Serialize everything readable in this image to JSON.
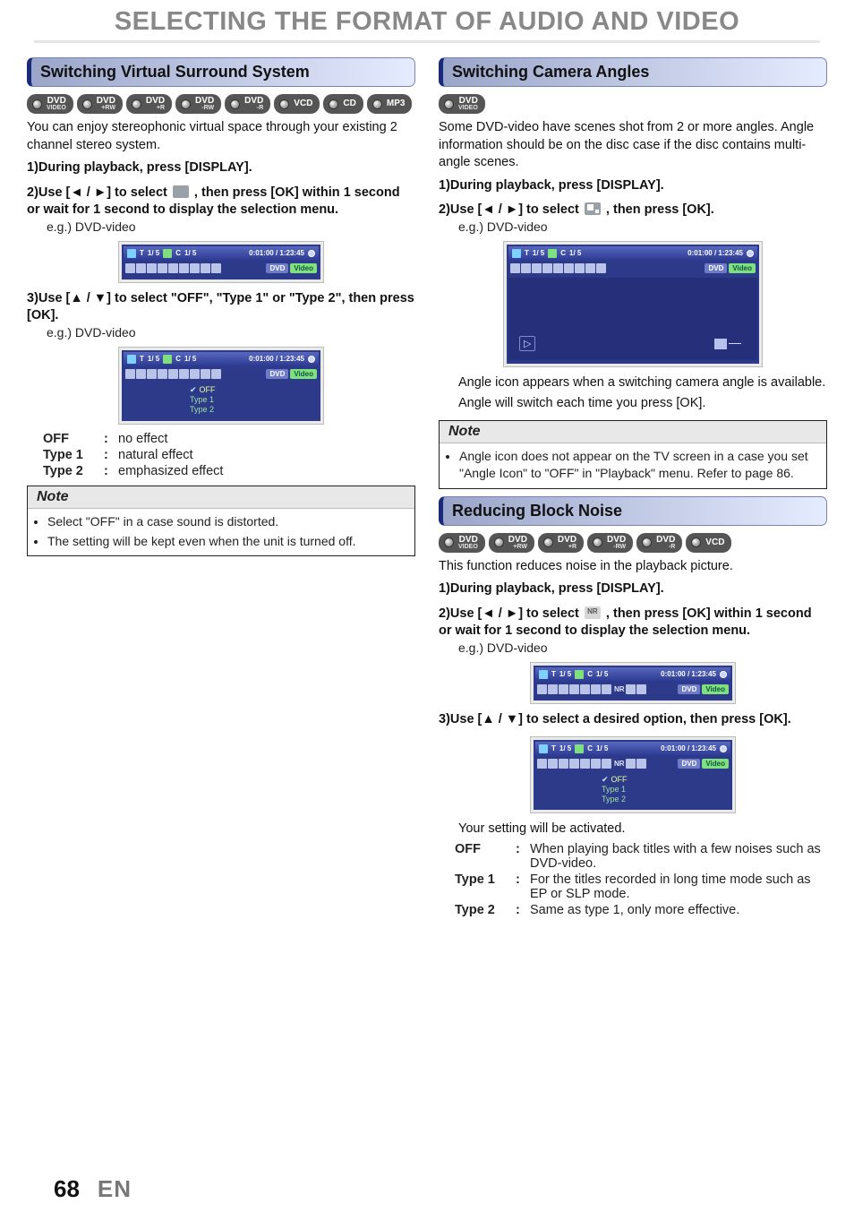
{
  "page": {
    "title": "SELECTING THE FORMAT OF AUDIO AND VIDEO",
    "number": "68",
    "lang": "EN"
  },
  "left": {
    "heading": "Switching Virtual Surround System",
    "badges": [
      "DVD VIDEO",
      "DVD +RW",
      "DVD +R",
      "DVD -RW",
      "DVD -R",
      "VCD",
      "CD",
      "MP3"
    ],
    "intro": "You can enjoy stereophonic virtual space through your existing 2 channel stereo system.",
    "steps": {
      "s1_n": "1)",
      "s1": "During playback, press [DISPLAY].",
      "s2_n": "2)",
      "s2_pre": "Use [",
      "s2_mid": "] to select ",
      "s2_post": " , then press [OK] within 1 second or wait for 1 second to display the selection menu.",
      "s2_eg": "e.g.) DVD-video",
      "s3_n": "3)",
      "s3": "Use [▲ / ▼] to select \"OFF\", \"Type 1\" or \"Type 2\", then press [OK].",
      "s3_eg": "e.g.) DVD-video"
    },
    "osd": {
      "t": "T",
      "t_val": "1/  5",
      "c": "C",
      "c_val": "1/  5",
      "time": "0:01:00 / 1:23:45",
      "tag1": "DVD",
      "tag2": "Video",
      "menu": [
        "OFF",
        "Type 1",
        "Type 2"
      ]
    },
    "defs": {
      "k1": "OFF",
      "v1": "no effect",
      "k2": "Type 1",
      "v2": "natural effect",
      "k3": "Type 2",
      "v3": "emphasized effect",
      "colon": ":"
    },
    "note": {
      "title": "Note",
      "items": [
        "Select \"OFF\" in a case sound is distorted.",
        "The setting will be kept even when the unit is turned off."
      ]
    }
  },
  "right_a": {
    "heading": "Switching Camera Angles",
    "badges": [
      "DVD VIDEO"
    ],
    "intro": "Some DVD-video have scenes shot from 2 or more angles. Angle information should be on the disc case if the disc contains multi-angle scenes.",
    "steps": {
      "s1_n": "1)",
      "s1": "During playback, press [DISPLAY].",
      "s2_n": "2)",
      "s2_pre": "Use [",
      "s2_mid": "] to select ",
      "s2_post": " , then press [OK].",
      "s2_eg": "e.g.) DVD-video"
    },
    "after": [
      "Angle icon appears when a switching camera angle is available.",
      "Angle will switch each time you press [OK]."
    ],
    "after_b_label": "[OK]",
    "note": {
      "title": "Note",
      "items": [
        "Angle icon does not appear on the TV screen in a case you set \"Angle Icon\" to \"OFF\" in \"Playback\" menu. Refer to page 86."
      ]
    },
    "osd_time": "0:01:00 / 1:23:45"
  },
  "right_b": {
    "heading": "Reducing Block Noise",
    "badges": [
      "DVD VIDEO",
      "DVD +RW",
      "DVD +R",
      "DVD -RW",
      "DVD -R",
      "VCD"
    ],
    "intro": "This function reduces noise in the playback picture.",
    "steps": {
      "s1_n": "1)",
      "s1": "During playback, press [DISPLAY].",
      "s2_n": "2)",
      "s2_pre": "Use [",
      "s2_mid": "] to select ",
      "s2_post": " , then press [OK] within 1 second or wait for 1 second to display the selection menu.",
      "s2_eg": "e.g.) DVD-video",
      "s3_n": "3)",
      "s3": "Use [▲ / ▼] to select a desired option, then press [OK]."
    },
    "after": "Your setting will be activated.",
    "defs": {
      "k1": "OFF",
      "v1": "When playing back titles with a few noises such as DVD-video.",
      "k2": "Type 1",
      "v2": "For the titles recorded in long time mode such as EP or SLP mode.",
      "k3": "Type 2",
      "v3": "Same as type 1, only more effective.",
      "colon": ":"
    },
    "osd": {
      "nr": "NR",
      "menu": [
        "OFF",
        "Type 1",
        "Type 2"
      ],
      "time": "0:01:00 / 1:23:45"
    }
  },
  "icons": {
    "left": "◄",
    "right": "►",
    "up": "▲",
    "down": "▼"
  }
}
